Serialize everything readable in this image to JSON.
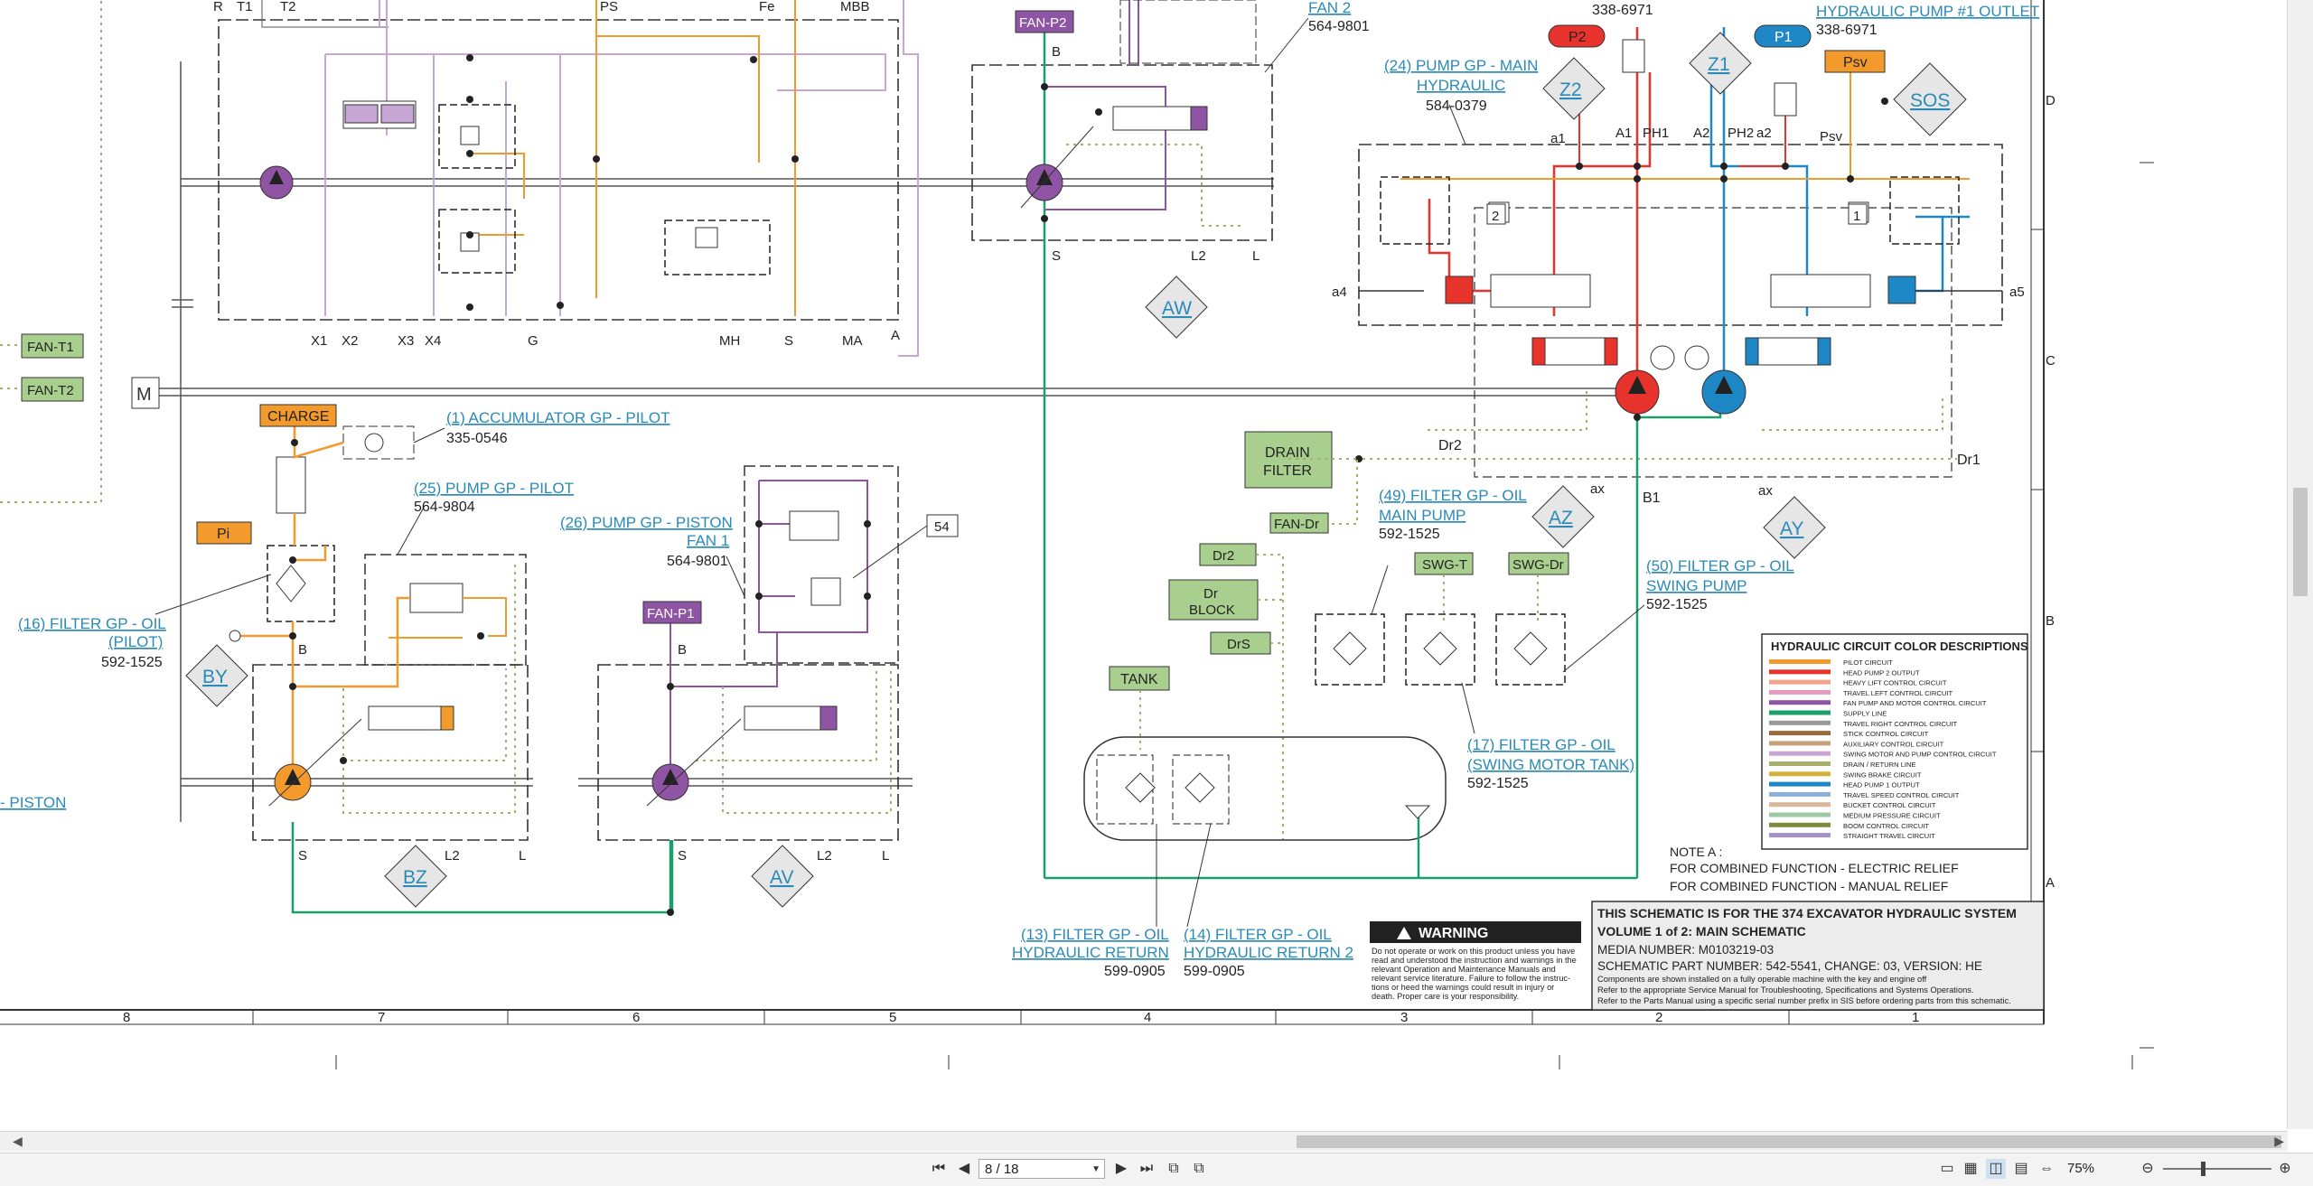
{
  "drawing": {
    "top_labels": [
      "R",
      "T1",
      "T2",
      "PS",
      "Fe",
      "MBB"
    ],
    "lower_ports": [
      "X1",
      "X2",
      "X3",
      "X4",
      "G",
      "MH",
      "S",
      "MA",
      "A"
    ],
    "fan_t1": "FAN-T1",
    "fan_t2": "FAN-T2",
    "m_label": "M",
    "fan2_link": "FAN 2",
    "fan2_part": "564-9801",
    "fan_p2": "FAN-P2",
    "fan_p2_b": "B",
    "fan_p2_s": "S",
    "fan_p2_l2": "L2",
    "fan_p2_l": "L",
    "aw": "AW",
    "part_338_a": "338-6971",
    "part_338_b": "338-6971",
    "pump1_outlet_link": "HYDRAULIC PUMP #1 OUTLET",
    "p2": "P2",
    "p1": "P1",
    "z2": "Z2",
    "z1": "Z1",
    "psv_box": "Psv",
    "sos": "SOS",
    "pump_main_link_1": "(24) PUMP GP - MAIN",
    "pump_main_link_2": "HYDRAULIC",
    "pump_main_part": "584-0379",
    "port_a1": "a1",
    "port_A1": "A1",
    "port_PH1": "PH1",
    "port_A2": "A2",
    "port_PH2": "PH2",
    "port_a2": "a2",
    "port_Psv": "Psv",
    "num2": "2",
    "num1": "1",
    "port_a4": "a4",
    "port_a5": "a5",
    "port_Dr2": "Dr2",
    "port_Dr1": "Dr1",
    "port_ax1": "ax",
    "port_ax2": "ax",
    "port_B1": "B1",
    "az": "AZ",
    "ay": "AY",
    "drain_filter_1": "DRAIN",
    "drain_filter_2": "FILTER",
    "filter49_1": "(49) FILTER GP - OIL",
    "filter49_2": "MAIN PUMP",
    "filter49_part": "592-1525",
    "fan_dr": "FAN-Dr",
    "swg_t": "SWG-T",
    "swg_dr": "SWG-Dr",
    "dr2": "Dr2",
    "dr_block_1": "Dr",
    "dr_block_2": "BLOCK",
    "drs": "DrS",
    "filter50_1": "(50) FILTER GP - OIL",
    "filter50_2": "SWING PUMP",
    "filter50_part": "592-1525",
    "tank": "TANK",
    "filter17_1": "(17) FILTER GP - OIL",
    "filter17_2": "(SWING MOTOR TANK)",
    "filter17_part": "592-1525",
    "filter13_1": "(13) FILTER GP - OIL",
    "filter13_2": "HYDRAULIC RETURN",
    "filter13_part": "599-0905",
    "filter14_1": "(14) FILTER GP - OIL",
    "filter14_2": "HYDRAULIC RETURN 2",
    "filter14_part": "599-0905",
    "charge": "CHARGE",
    "acc_link": "(1) ACCUMULATOR GP - PILOT",
    "acc_part": "335-0546",
    "pump_pilot_link": "(25) PUMP GP - PILOT",
    "pump_pilot_part": "564-9804",
    "pi": "Pi",
    "filter16_1": "(16) FILTER GP - OIL",
    "filter16_2": "(PILOT)",
    "filter16_part": "592-1525",
    "by": "BY",
    "port_b_pilot": "B",
    "port_s_pilot": "S",
    "port_l2_pilot": "L2",
    "port_l_pilot": "L",
    "bz": "BZ",
    "piston_link": "- PISTON",
    "fan1_link_1": "(26) PUMP GP - PISTON",
    "fan1_link_2": "FAN 1",
    "fan1_part": "564-9801",
    "num54": "54",
    "fan_p1": "FAN-P1",
    "port_b_fan1": "B",
    "port_s_fan1": "S",
    "port_l2_fan1": "L2",
    "port_l_fan1": "L",
    "av": "AV",
    "legend_title": "HYDRAULIC CIRCUIT COLOR DESCRIPTIONS",
    "legend_items": [
      {
        "label": "PILOT CIRCUIT",
        "color": "#f39a2c"
      },
      {
        "label": "HEAD PUMP 2 OUTPUT",
        "color": "#e8332d"
      },
      {
        "label": "HEAVY LIFT CONTROL CIRCUIT",
        "color": "#f2a58b"
      },
      {
        "label": "TRAVEL LEFT CONTROL CIRCUIT",
        "color": "#e79ac0"
      },
      {
        "label": "FAN PUMP AND MOTOR CONTROL CIRCUIT",
        "color": "#8f54a3"
      },
      {
        "label": "SUPPLY LINE",
        "color": "#1a9f6a"
      },
      {
        "label": "TRAVEL RIGHT CONTROL CIRCUIT",
        "color": "#9a9a9a"
      },
      {
        "label": "STICK CONTROL CIRCUIT",
        "color": "#9b6a3a"
      },
      {
        "label": "AUXILIARY CONTROL CIRCUIT",
        "color": "#c8a078"
      },
      {
        "label": "SWING MOTOR AND PUMP CONTROL CIRCUIT",
        "color": "#c7a6d6"
      },
      {
        "label": "DRAIN / RETURN LINE",
        "color": "#a6ae6a"
      },
      {
        "label": "SWING BRAKE CIRCUIT",
        "color": "#d4b13a"
      },
      {
        "label": "HEAD PUMP 1 OUTPUT",
        "color": "#1e88c7"
      },
      {
        "label": "TRAVEL SPEED CONTROL CIRCUIT",
        "color": "#8cb0d8"
      },
      {
        "label": "BUCKET CONTROL CIRCUIT",
        "color": "#d8b79a"
      },
      {
        "label": "MEDIUM PRESSURE CIRCUIT",
        "color": "#9ec9a6"
      },
      {
        "label": "BOOM CONTROL CIRCUIT",
        "color": "#7f8a3a"
      },
      {
        "label": "STRAIGHT TRAVEL CIRCUIT",
        "color": "#a592c6"
      }
    ],
    "note_title": "NOTE A :",
    "note_line1": "FOR COMBINED FUNCTION - ELECTRIC RELIEF",
    "note_line2": "FOR COMBINED FUNCTION - MANUAL RELIEF",
    "warning_title": "WARNING",
    "warning_text": [
      "Do not operate or work on this product unless you have",
      "read and understood the instruction and warnings in the",
      "relevant Operation and Maintenance Manuals and",
      "relevant service literature. Failure to follow the instruc-",
      "tions or heed the warnings could result in injury or",
      "death. Proper care is your responsibility."
    ],
    "title_line1": "THIS SCHEMATIC IS FOR THE 374 EXCAVATOR HYDRAULIC SYSTEM",
    "title_line2": "VOLUME 1 of 2: MAIN SCHEMATIC",
    "media_number": "MEDIA NUMBER: M0103219-03",
    "part_number": "SCHEMATIC PART NUMBER: 542-5541, CHANGE: 03, VERSION: HE",
    "title_notes": [
      "Components are shown installed on a fully operable machine with the key and engine off",
      "Refer to the appropriate Service Manual for Troubleshooting, Specifications and Systems Operations.",
      "Refer to the Parts Manual using a specific serial number prefix in SIS before ordering parts from this schematic."
    ],
    "grid_cols": [
      "8",
      "7",
      "6",
      "5",
      "4",
      "3",
      "2",
      "1"
    ],
    "grid_rows": [
      "D",
      "C",
      "B",
      "A"
    ]
  },
  "viewer": {
    "page_value": "8 / 18",
    "zoom": "75%"
  }
}
